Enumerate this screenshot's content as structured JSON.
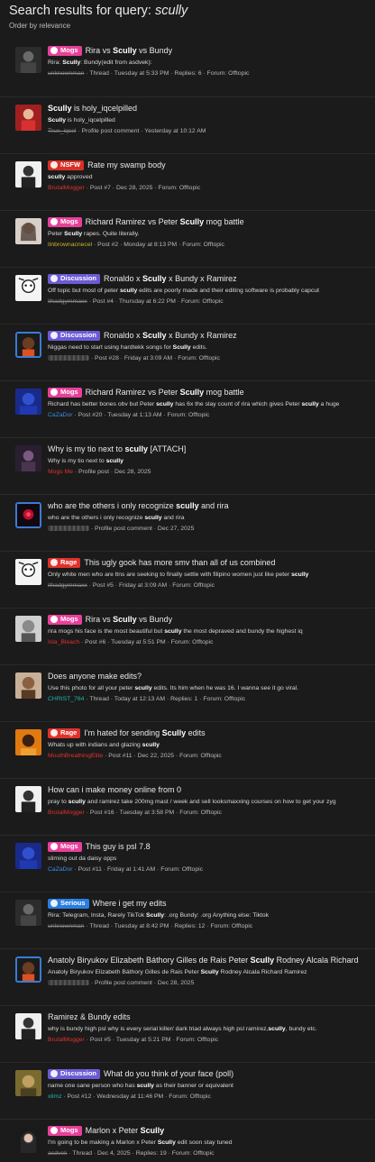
{
  "header": {
    "title_prefix": "Search results for query: ",
    "query": "scully",
    "order_label": "Order by relevance"
  },
  "results": [
    {
      "badge": "Mogs",
      "badge_type": "mogs",
      "title_pre": "Rira vs ",
      "title_hl": "Scully",
      "title_post": " vs Bundy",
      "snippet": "Rira: Scully: Bundy(edit from asdvek):",
      "user": "unknownman",
      "user_style": "red-strike",
      "meta": " · Thread · Tuesday at 5:33 PM · Replies: 6 · Forum: Offtopic",
      "avatar": "dark"
    },
    {
      "badge": "",
      "badge_type": "",
      "title_pre": "",
      "title_hl": "Scully",
      "title_post": " is holy_iqcelpilled",
      "snippet": "Scully is holy_iqcelpilled",
      "user": "True_iqcel",
      "user_style": "strike",
      "meta": " · Profile post comment · Yesterday at 10:12 AM",
      "avatar": "red"
    },
    {
      "badge": "NSFW",
      "badge_type": "nsfw",
      "title_pre": "Rate my swamp body",
      "title_hl": "",
      "title_post": "",
      "snippet": "scully approved",
      "user": "BrutalMogger",
      "user_style": "red",
      "meta": " · Post #7 · Dec 28, 2025 · Forum: Offtopic",
      "avatar": "blackwhite"
    },
    {
      "badge": "Mogs",
      "badge_type": "mogs",
      "title_pre": "Richard Ramirez vs Peter ",
      "title_hl": "Scully",
      "title_post": " mog battle",
      "snippet": "Peter Scully rapes. Quite literally.",
      "user": "itnbrownacnecel",
      "user_style": "yellow",
      "meta": " · Post #2 · Monday at 8:13 PM · Forum: Offtopic",
      "avatar": "woman"
    },
    {
      "badge": "Discussion",
      "badge_type": "discussion",
      "title_pre": "Ronaldo x ",
      "title_hl": "Scully",
      "title_post": " x Bundy x Ramirez",
      "snippet": "Off topic but most of peter scully edits are poorly made and their editing software is probably capcut",
      "user": "ithadgymmaxx",
      "user_style": "strike",
      "meta": " · Post #4 · Thursday at 6:22 PM · Forum: Offtopic",
      "avatar": "cartoon"
    },
    {
      "badge": "Discussion",
      "badge_type": "discussion",
      "title_pre": "Ronaldo x ",
      "title_hl": "Scully",
      "title_post": " x Bundy x Ramirez",
      "snippet": "Niggas need to start using hardtekk songs for Scully edits.",
      "user": "",
      "user_style": "redact",
      "meta": " · Post #28 · Friday at 3:09 AM · Forum: Offtopic",
      "avatar": "face-ring"
    },
    {
      "badge": "Mogs",
      "badge_type": "mogs",
      "title_pre": "Richard Ramirez vs Peter ",
      "title_hl": "Scully",
      "title_post": " mog battle",
      "snippet": "Richard has better bones obv but Peter scully has 6x the slay count of rira which gives Peter scully a huge",
      "user": "CaZaDor",
      "user_style": "blue",
      "meta": " · Post #20 · Tuesday at 1:13 AM · Forum: Offtopic",
      "avatar": "blue"
    },
    {
      "badge": "",
      "badge_type": "",
      "title_pre": "Why is my tio next to ",
      "title_hl": "scully",
      "title_post": " [ATTACH]",
      "snippet": "Why is my tio next to scully",
      "user": "Mogs Me",
      "user_style": "red",
      "meta": " · Profile post · Dec 28, 2025",
      "avatar": "purple"
    },
    {
      "badge": "",
      "badge_type": "",
      "title_pre": "who are the others i only recognize ",
      "title_hl": "scully",
      "title_post": " and rira",
      "snippet": "who are the others i only recognize scully and rira",
      "user": "",
      "user_style": "redact",
      "meta": " · Profile post comment · Dec 27, 2025",
      "avatar": "redglow-ring"
    },
    {
      "badge": "Rage",
      "badge_type": "rage",
      "title_pre": "This ugly gook has more smv than all of us combined",
      "title_hl": "",
      "title_post": "",
      "snippet": "Only white men who are ltns are seeking to finally settle with filipino women just like peter scully",
      "user": "ithadgymmaxx",
      "user_style": "strike",
      "meta": " · Post #5 · Friday at 3:09 AM · Forum: Offtopic",
      "avatar": "cartoon"
    },
    {
      "badge": "Mogs",
      "badge_type": "mogs",
      "title_pre": "Rira vs ",
      "title_hl": "Scully",
      "title_post": " vs Bundy",
      "snippet": "rira mogs his face is the most beautiful but scully the most depraved and bundy the highest iq",
      "user": "Isla_Bleach",
      "user_style": "red",
      "meta": " · Post #6 · Tuesday at 5:51 PM · Forum: Offtopic",
      "avatar": "gray"
    },
    {
      "badge": "",
      "badge_type": "",
      "title_pre": "Does anyone make edits?",
      "title_hl": "",
      "title_post": "",
      "snippet": "Use this photo for all your peter scully edits. Its him when he was 16. I wanna see it go viral.",
      "user": "CHRIST_764",
      "user_style": "teal",
      "meta": " · Thread · Today at 12:13 AM · Replies: 1 · Forum: Offtopic",
      "avatar": "tan"
    },
    {
      "badge": "Rage",
      "badge_type": "rage",
      "title_pre": "I'm hated for sending ",
      "title_hl": "Scully",
      "title_post": " edits",
      "snippet": "Whats up with indians and glazing scully",
      "user": "MouthBreathingElite",
      "user_style": "red",
      "meta": " · Post #11 · Dec 22, 2025 · Forum: Offtopic",
      "avatar": "orange"
    },
    {
      "badge": "",
      "badge_type": "",
      "title_pre": "How can i make money online from 0",
      "title_hl": "",
      "title_post": "",
      "snippet": "pray to scully and ramirez take 200mg mast / week and sell looksmaxxing courses on how to get your zyg",
      "user": "BrutalMogger",
      "user_style": "red",
      "meta": " · Post #16 · Tuesday at 3:58 PM · Forum: Offtopic",
      "avatar": "blackwhite"
    },
    {
      "badge": "Mogs",
      "badge_type": "mogs",
      "title_pre": "This guy is psl 7.8",
      "title_hl": "",
      "title_post": "",
      "snippet": "sliming out da daisy opps",
      "user": "CaZaDor",
      "user_style": "blue",
      "meta": " · Post #11 · Friday at 1:41 AM · Forum: Offtopic",
      "avatar": "blue"
    },
    {
      "badge": "Serious",
      "badge_type": "serious",
      "title_pre": "Where i get my edits",
      "title_hl": "",
      "title_post": "",
      "snippet": "Rira: Telegram, Insta, Rarely TikTok Scully: .org Bundy: .org Anything else: Tiktok",
      "user": "unknownman",
      "user_style": "red-strike",
      "meta": " · Thread · Tuesday at 8:42 PM · Replies: 12 · Forum: Offtopic",
      "avatar": "dark"
    },
    {
      "badge": "",
      "badge_type": "",
      "title_pre": "Anatoly Biryukov Elizabeth Báthory Gilles de Rais Peter ",
      "title_hl": "Scully",
      "title_post": " Rodney Alcala Richard",
      "snippet": "Anatoly Biryukov Elizabeth Báthory Gilles de Rais Peter Scully Rodney Alcala Richard Ramirez",
      "user": "",
      "user_style": "redact",
      "meta": " · Profile post comment · Dec 28, 2025",
      "avatar": "face-ring"
    },
    {
      "badge": "",
      "badge_type": "",
      "title_pre": "Ramirez & Bundy edits",
      "title_hl": "",
      "title_post": "",
      "snippet": "why is bundy high psl why is every serial killer/ dark triad always high psl ramirez,scully, bundy etc.",
      "user": "BrutalMogger",
      "user_style": "red",
      "meta": " · Post #5 · Tuesday at 5:21 PM · Forum: Offtopic",
      "avatar": "blackwhite"
    },
    {
      "badge": "Discussion",
      "badge_type": "discussion",
      "title_pre": "What do you think of your face (poll)",
      "title_hl": "",
      "title_post": "",
      "snippet": "name one sane person who has scully as their banner or equivalent",
      "user": "xlimz",
      "user_style": "teal",
      "meta": " · Post #12 · Wednesday at 11:46 PM · Forum: Offtopic",
      "avatar": "olive"
    },
    {
      "badge": "Mogs",
      "badge_type": "mogs",
      "title_pre": "Marlon x Peter ",
      "title_hl": "Scully",
      "title_post": "",
      "snippet": "I'm going to be making a Marlon x Peter Scully edit soon stay tuned",
      "user": "asdvek",
      "user_style": "red-strike",
      "meta": " · Thread · Dec 4, 2025 · Replies: 19 · Forum: Offtopic",
      "avatar": "woman2"
    }
  ]
}
